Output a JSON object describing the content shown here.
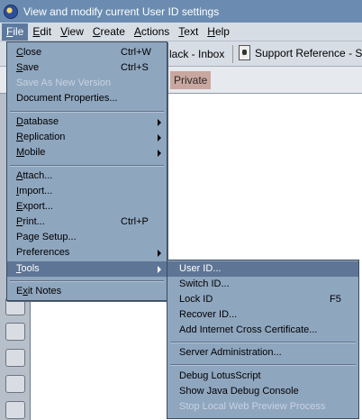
{
  "window": {
    "title": "View and modify current User ID settings"
  },
  "menubar": {
    "items": [
      {
        "label": "File",
        "key": "F",
        "rest": "ile"
      },
      {
        "label": "Edit",
        "key": "E",
        "rest": "dit"
      },
      {
        "label": "View",
        "key": "V",
        "rest": "iew"
      },
      {
        "label": "Create",
        "key": "C",
        "rest": "reate"
      },
      {
        "label": "Actions",
        "key": "A",
        "rest": "ctions"
      },
      {
        "label": "Text",
        "key": "T",
        "rest": "ext"
      },
      {
        "label": "Help",
        "key": "H",
        "rest": "elp"
      }
    ]
  },
  "tabs": [
    {
      "label": "lack - Inbox"
    },
    {
      "label": "Support Reference - Sup",
      "icon": "document-icon"
    }
  ],
  "view": {
    "chip": "Private"
  },
  "file_menu": {
    "close": {
      "key": "C",
      "rest": "lose",
      "shortcut": "Ctrl+W"
    },
    "save": {
      "key": "S",
      "rest": "ave",
      "shortcut": "Ctrl+S"
    },
    "save_as_new_version": {
      "label": "Save As New Version"
    },
    "document_properties": {
      "label": "Document Properties..."
    },
    "database": {
      "key": "D",
      "rest": "atabase"
    },
    "replication": {
      "key": "R",
      "rest": "eplication"
    },
    "mobile": {
      "key": "M",
      "rest": "obile"
    },
    "attach": {
      "key": "A",
      "rest": "ttach..."
    },
    "import": {
      "key": "I",
      "rest": "mport..."
    },
    "export": {
      "key": "E",
      "rest": "xport..."
    },
    "print": {
      "key": "P",
      "rest": "rint...",
      "shortcut": "Ctrl+P"
    },
    "page_setup": {
      "label": "Page Setup..."
    },
    "preferences": {
      "label": "Preferences"
    },
    "tools": {
      "key": "T",
      "rest": "ools"
    },
    "exit_notes": {
      "key": "x",
      "pre": "E",
      "rest": "it Notes"
    }
  },
  "tools_menu": {
    "user_id": {
      "label": "User ID..."
    },
    "switch_id": {
      "label": "Switch ID..."
    },
    "lock_id": {
      "label": "Lock ID",
      "shortcut": "F5"
    },
    "recover_id": {
      "label": "Recover ID..."
    },
    "add_cross_cert": {
      "label": "Add Internet Cross Certificate..."
    },
    "server_admin": {
      "label": "Server Administration..."
    },
    "debug_lotusscript": {
      "label": "Debug LotusScript"
    },
    "java_debug": {
      "label": "Show Java Debug Console"
    },
    "stop_web_preview": {
      "label": "Stop Local Web Preview Process"
    }
  }
}
